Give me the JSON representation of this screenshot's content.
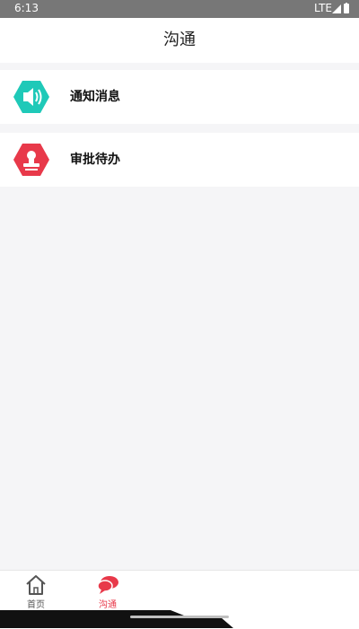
{
  "status_bar": {
    "time": "6:13",
    "network": "LTE"
  },
  "header": {
    "title": "沟通"
  },
  "list": {
    "items": [
      {
        "label": "通知消息",
        "icon": "speaker-icon",
        "color": "#1FC9B8"
      },
      {
        "label": "审批待办",
        "icon": "stamp-icon",
        "color": "#E8394A"
      }
    ]
  },
  "tab_bar": {
    "tabs": [
      {
        "label": "首页",
        "icon": "home-icon",
        "active": false
      },
      {
        "label": "沟通",
        "icon": "chat-icon",
        "active": true
      }
    ],
    "active_color": "#E8394A",
    "inactive_color": "#555555"
  }
}
